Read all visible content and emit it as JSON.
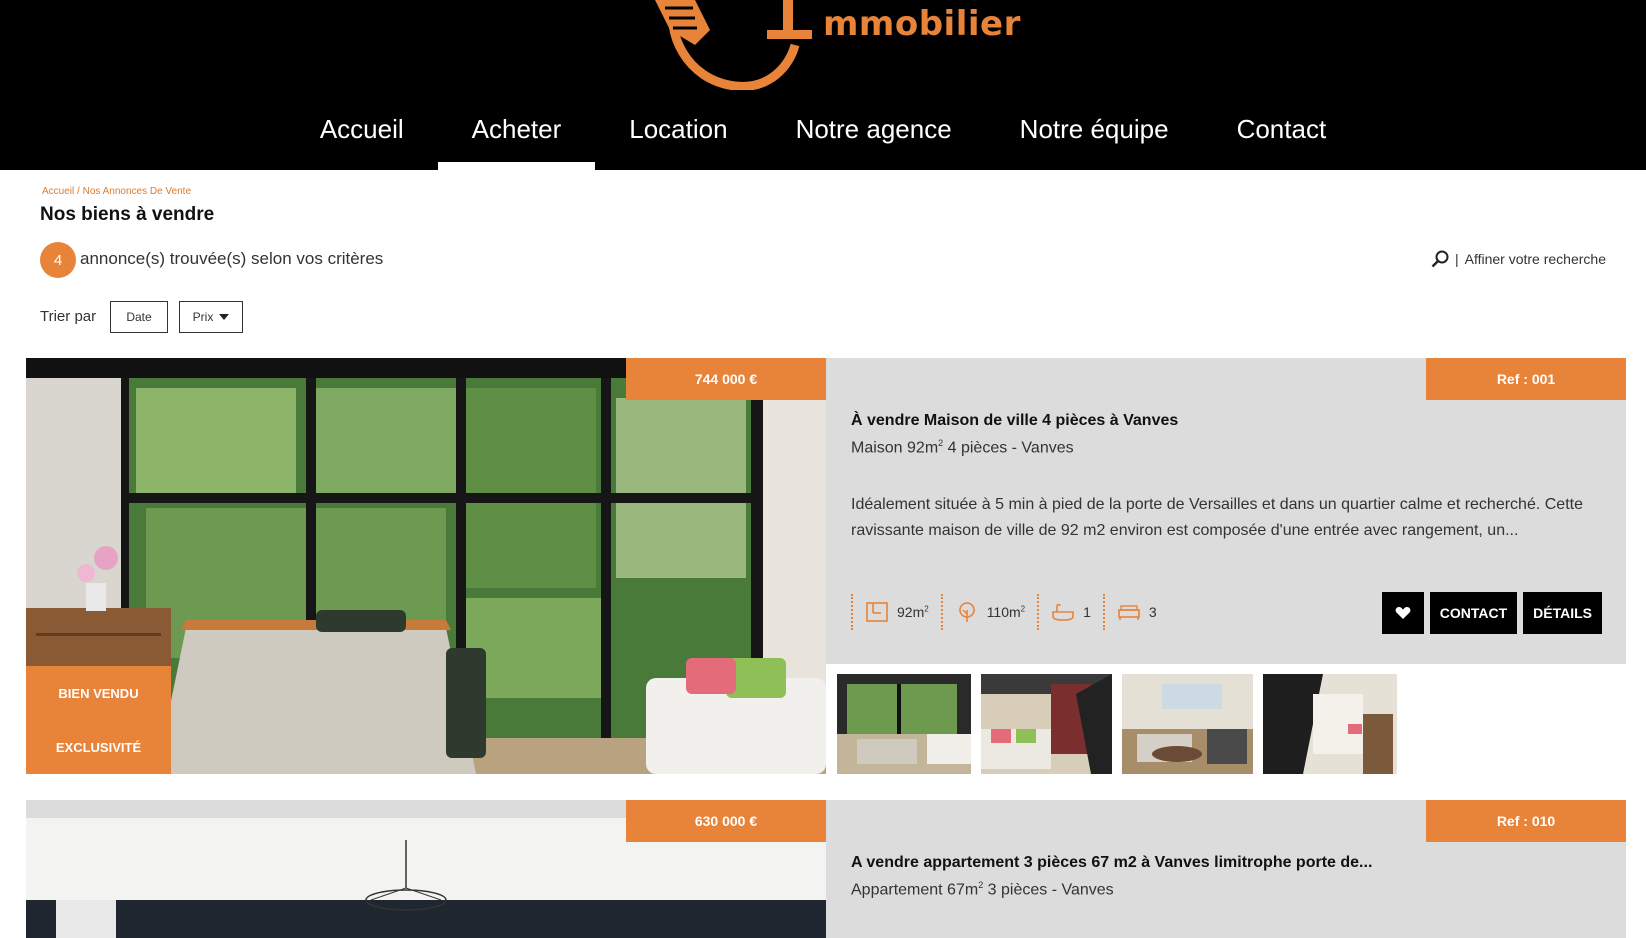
{
  "brand": {
    "logo_text": "mmobilier",
    "accent": "#e8833a"
  },
  "nav": {
    "items": [
      {
        "label": "Accueil"
      },
      {
        "label": "Acheter",
        "active": true
      },
      {
        "label": "Location"
      },
      {
        "label": "Notre agence"
      },
      {
        "label": "Notre équipe"
      },
      {
        "label": "Contact"
      }
    ]
  },
  "breadcrumb": {
    "home": "Accueil",
    "separator": "/",
    "current": "Nos Annonces De Vente"
  },
  "page": {
    "title": "Nos biens à vendre",
    "count": "4",
    "count_text": "annonce(s) trouvée(s) selon vos critères",
    "refine_label": "Affiner votre recherche",
    "sort_label": "Trier par",
    "sort_date": "Date",
    "sort_price": "Prix"
  },
  "listings": [
    {
      "price": "744 000 €",
      "ref": "Ref : 001",
      "title": "À vendre Maison de ville 4 pièces à Vanves",
      "subtitle_prefix": "Maison 92m",
      "subtitle_suffix": " 4 pièces - Vanves",
      "description": "Idéalement située à 5 min à pied de la porte de Versailles et dans un quartier calme et recherché. Cette ravissante maison de ville de 92 m2 environ est composée d'une entrée avec rangement, un...",
      "features": {
        "surface": "92m",
        "land": "110m",
        "bathrooms": "1",
        "bedrooms": "3"
      },
      "status_badge": "BIEN VENDU",
      "exclusive_badge": "EXCLUSIVITÉ",
      "contact_label": "CONTACT",
      "details_label": "DÉTAILS"
    },
    {
      "price": "630 000 €",
      "ref": "Ref : 010",
      "title": "A vendre appartement 3 pièces 67 m2 à Vanves limitrophe porte de...",
      "subtitle_prefix": "Appartement 67m",
      "subtitle_suffix": " 3 pièces - Vanves"
    }
  ],
  "superscript": "2"
}
